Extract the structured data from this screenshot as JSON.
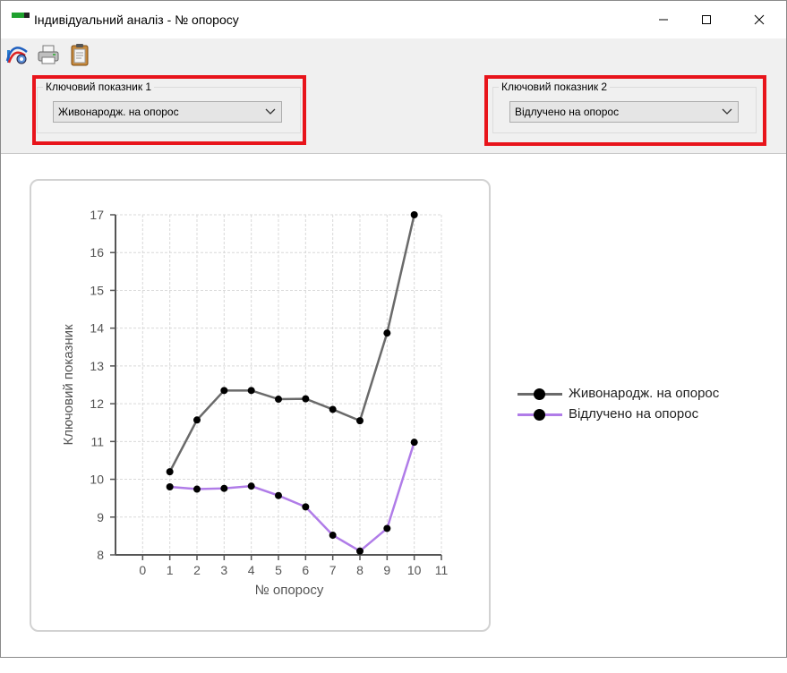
{
  "window": {
    "title": "Індивідуальний аналіз - № опоросу"
  },
  "controls": {
    "key1": {
      "label": "Ключовий показник 1",
      "value": "Живонародж. на опорос"
    },
    "key2": {
      "label": "Ключовий показник 2",
      "value": "Відлучено на опорос"
    }
  },
  "toolbar": {
    "icons": [
      "chart-settings-icon",
      "printer-icon",
      "clipboard-icon"
    ]
  },
  "colors": {
    "series1": "#6a6a6a",
    "series2": "#b07ce8",
    "highlight": "#e8141b"
  },
  "chart_data": {
    "type": "line",
    "xlabel": "№ опоросу",
    "ylabel": "Ключовий показник",
    "xlim": [
      -1,
      11
    ],
    "ylim": [
      8,
      17
    ],
    "xticks": [
      0,
      1,
      2,
      3,
      4,
      5,
      6,
      7,
      8,
      9,
      10,
      11
    ],
    "yticks": [
      8,
      9,
      10,
      11,
      12,
      13,
      14,
      15,
      16,
      17
    ],
    "grid": true,
    "legend_position": "right",
    "x": [
      1,
      2,
      3,
      4,
      5,
      6,
      7,
      8,
      9,
      10
    ],
    "series": [
      {
        "name": "Живонародж. на опорос",
        "color": "#6a6a6a",
        "values": [
          10.2,
          11.57,
          12.35,
          12.35,
          12.12,
          12.13,
          11.85,
          11.55,
          13.87,
          17.0
        ]
      },
      {
        "name": "Відлучено на опорос",
        "color": "#b07ce8",
        "values": [
          9.8,
          9.74,
          9.76,
          9.82,
          9.57,
          9.27,
          8.52,
          8.1,
          8.7,
          10.98
        ]
      }
    ]
  }
}
